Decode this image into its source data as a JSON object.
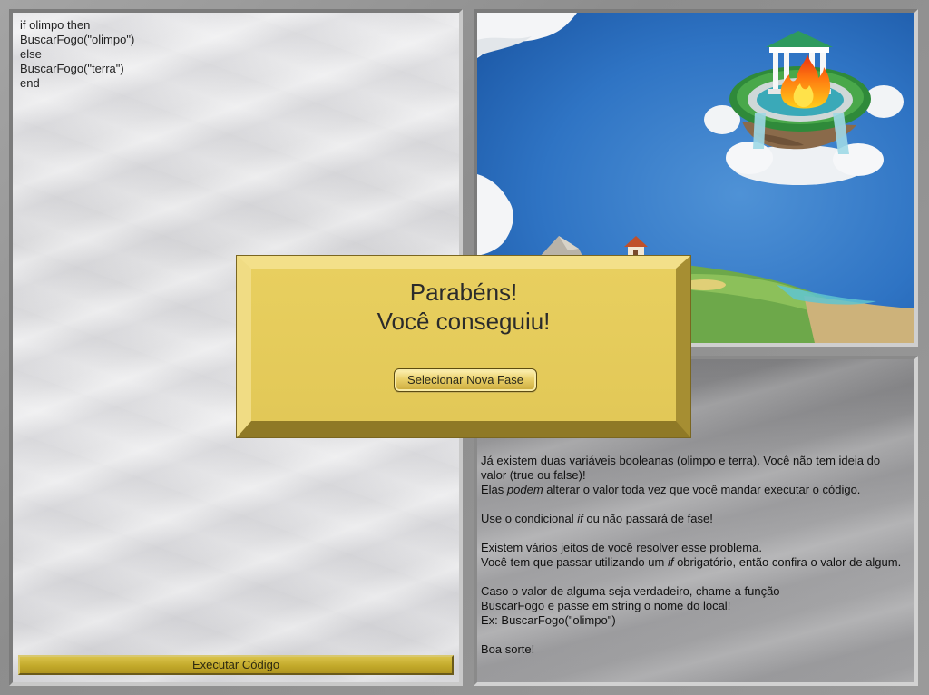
{
  "editor": {
    "code": "if olimpo then\nBuscarFogo(\"olimpo\")\nelse\nBuscarFogo(\"terra\")\nend",
    "run_button_label": "Executar Código"
  },
  "modal": {
    "title_line1": "Parabéns!",
    "title_line2": "Você conseguiu!",
    "button_label": "Selecionar Nova Fase"
  },
  "instructions": {
    "p1_line1": "Já existem duas variáveis booleanas (olimpo e terra). Você não tem ideia do valor (true ou false)!",
    "p1_line2_before": "Elas ",
    "p1_line2_em": "podem",
    "p1_line2_after": " alterar o valor toda vez que você mandar executar o código.",
    "p2_before": "Use o condicional ",
    "p2_em": "if",
    "p2_after": " ou não passará de fase!",
    "p3_line1": "Existem vários jeitos de você resolver esse problema.",
    "p3_line2_before": "Você tem que passar utilizando um ",
    "p3_line2_em": "if",
    "p3_line2_after": " obrigatório, então confira o valor de algum.",
    "p4_line1": "Caso o valor de alguma seja verdadeiro, chame a função",
    "p4_line2": "BuscarFogo e passe em string o nome do local!",
    "p4_line3": "Ex: BuscarFogo(\"olimpo\")",
    "p5": "Boa sorte!"
  },
  "scene": {
    "icons": [
      "olympus-temple-icon",
      "fire-icon",
      "cloud-icon",
      "village-house-icon",
      "mountain-icon"
    ]
  },
  "colors": {
    "sky": "#2a6fc0",
    "modal": "#e3c95c",
    "run_button": "#c2a92a"
  }
}
